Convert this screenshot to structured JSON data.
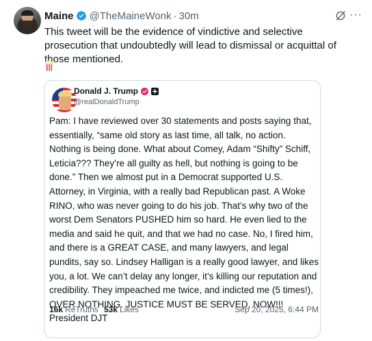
{
  "tweet": {
    "author_name": "Maine",
    "author_handle": "@TheMaineWonk",
    "separator": "·",
    "time": "30m",
    "text": "This tweet will be the evidence of vindictive and selective prosecution that undoubtedly will lead to dismissal or acquittal of those mentioned.",
    "more_label": "···",
    "verified_color": "#1d9bf0"
  },
  "quote": {
    "author_name": "Donald J. Trump",
    "author_handle": "@realDonaldTrump",
    "body": "Pam: I have reviewed over 30 statements and posts saying that, essentially, “same old story as last time, all talk, no action. Nothing is being done. What about Comey, Adam “Shifty” Schiff, Leticia??? They’re all guilty as hell, but nothing is going to be done.” Then we almost put in a Democrat supported U.S. Attorney, in Virginia, with a really bad Republican past. A Woke RINO, who was never going to do his job. That’s why two of the worst Dem Senators PUSHED him so hard. He even lied to the media and said he quit, and that we had no case. No, I fired him, and there is a GREAT CASE, and many lawyers, and legal pundits, say so. Lindsey Halligan is a really good lawyer, and likes you, a lot. We can’t delay any longer, it’s killing our reputation and credibility. They impeached me twice, and indicted me (5 times!), OVER NOTHING. JUSTICE MUST BE SERVED, NOW!!! President DJT",
    "retruths_count": "16k",
    "retruths_label": "ReTruths",
    "likes_count": "53k",
    "likes_label": "Likes",
    "date": "Sep 20, 2025, 6:44 PM",
    "badge_color": "#e0245e"
  }
}
